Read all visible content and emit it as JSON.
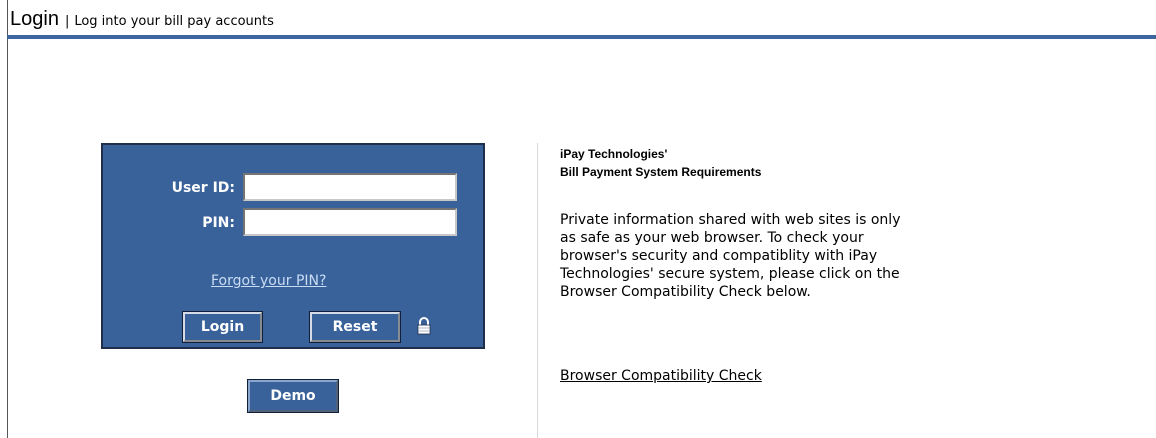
{
  "header": {
    "title": "Login",
    "separator": "|",
    "subtitle": "Log into your bill pay accounts"
  },
  "login_form": {
    "user_id_label": "User ID:",
    "user_id_value": "",
    "pin_label": "PIN:",
    "pin_value": "",
    "forgot_pin_link": "Forgot your PIN?",
    "login_button": "Login",
    "reset_button": "Reset",
    "lock_icon": "lock-icon"
  },
  "demo_button": "Demo",
  "requirements": {
    "title_line1": "iPay Technologies'",
    "title_line2": "Bill Payment System Requirements",
    "line1": "Private information shared with web sites is only",
    "line2": "as safe as your web browser. To check your",
    "line3": "browser's security and compatiblity with iPay",
    "line4": "Technologies' secure system, please click on the",
    "line5": "Browser Compatibility Check below.",
    "compat_link": "Browser Compatibility Check"
  },
  "colors": {
    "panel_background": "#39629b",
    "header_bar": "#3d66a0",
    "link_on_panel": "#c9dcf3"
  }
}
